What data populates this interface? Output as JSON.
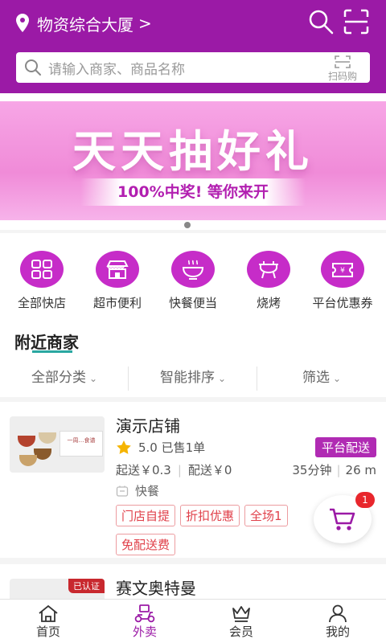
{
  "header": {
    "location": "物资综合大厦",
    "location_chevron": ">",
    "search_placeholder": "请输入商家、商品名称",
    "scan_buy_label": "扫码购"
  },
  "banner": {
    "headline": "天天抽好礼",
    "subline": "100%中奖! 等你来开"
  },
  "categories": [
    {
      "label": "全部快店",
      "icon": "grid-icon"
    },
    {
      "label": "超市便利",
      "icon": "store-icon"
    },
    {
      "label": "快餐便当",
      "icon": "bowl-icon"
    },
    {
      "label": "烧烤",
      "icon": "grill-icon"
    },
    {
      "label": "平台优惠券",
      "icon": "coupon-icon"
    }
  ],
  "nearby": {
    "title": "附近商家",
    "filters": [
      {
        "label": "全部分类",
        "caret": "⌄"
      },
      {
        "label": "智能排序",
        "caret": "⌄"
      },
      {
        "label": "筛选",
        "caret": "⌄"
      }
    ]
  },
  "shops": [
    {
      "name": "演示店铺",
      "rating": "5.0",
      "sold": "已售1单",
      "delivery_tag": "平台配送",
      "min_order": "起送￥0.3",
      "delivery_fee": "配送￥0",
      "time": "35分钟",
      "distance": "26 m",
      "category": "快餐",
      "thumb_text": "一周…食谱",
      "promos_row1": [
        "门店自提",
        "折扣优惠",
        "全场1"
      ],
      "promos_row2": [
        "免配送费"
      ]
    },
    {
      "name": "赛文奥特曼",
      "verified": "已认证"
    }
  ],
  "cart": {
    "badge": "1"
  },
  "tabbar": [
    {
      "label": "首页",
      "icon": "home-icon",
      "active": false
    },
    {
      "label": "外卖",
      "icon": "scooter-icon",
      "active": true
    },
    {
      "label": "会员",
      "icon": "crown-icon",
      "active": false
    },
    {
      "label": "我的",
      "icon": "user-icon",
      "active": false
    }
  ],
  "colors": {
    "brand": "#9b1aa6",
    "icon_circle": "#c62cc8",
    "promo": "#e0404a",
    "underline": "#2aa7a1"
  }
}
